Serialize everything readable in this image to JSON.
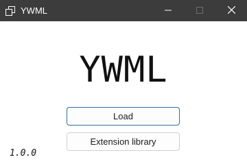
{
  "titlebar": {
    "title": "YWML",
    "icon": "app-window-icon",
    "controls": [
      "minimize-icon",
      "maximize-icon",
      "close-icon"
    ]
  },
  "main": {
    "logo_text": "YWML",
    "load_label": "Load",
    "extension_label": "Extension library",
    "version": "1.0.0"
  },
  "colors": {
    "titlebar_bg": "#3c3c3c",
    "focused_border": "#2f6f9f"
  }
}
